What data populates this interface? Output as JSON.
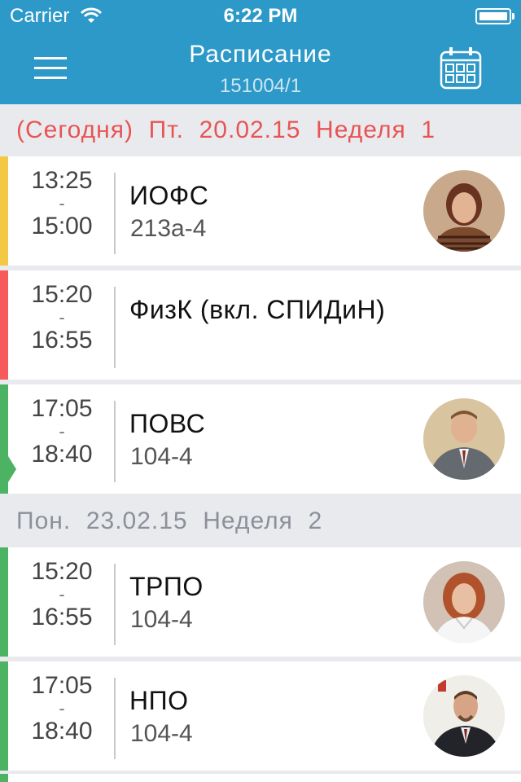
{
  "status": {
    "carrier": "Carrier",
    "time": "6:22 PM"
  },
  "nav": {
    "title": "Расписание",
    "subtitle": "151004/1",
    "menu_icon": "hamburger-icon",
    "calendar_icon": "calendar-icon"
  },
  "colors": {
    "header": "#2c99c8",
    "today": "#e85454",
    "yellow": "#f3c845",
    "red": "#f65a5a",
    "green": "#4cb363",
    "day_gray": "#8c9099"
  },
  "days": [
    {
      "header": "(Сегодня)  Пт.  20.02.15  Неделя  1",
      "lessons": [
        {
          "start": "13:25",
          "sep": "-",
          "end": "15:00",
          "subject": "ИОФС",
          "room": "213а-4",
          "color": "#f3c845"
        },
        {
          "start": "15:20",
          "sep": "-",
          "end": "16:55",
          "subject": "ФизК (вкл. СПИДиН)",
          "room": "",
          "color": "#f65a5a"
        },
        {
          "start": "17:05",
          "sep": "-",
          "end": "18:40",
          "subject": "ПОВС",
          "room": "104-4",
          "color": "#4cb363"
        }
      ]
    },
    {
      "header": "Пон.  23.02.15  Неделя  2",
      "lessons": [
        {
          "start": "15:20",
          "sep": "-",
          "end": "16:55",
          "subject": "ТРПО",
          "room": "104-4",
          "color": "#4cb363"
        },
        {
          "start": "17:05",
          "sep": "-",
          "end": "18:40",
          "subject": "НПО",
          "room": "104-4",
          "color": "#4cb363"
        }
      ]
    }
  ]
}
